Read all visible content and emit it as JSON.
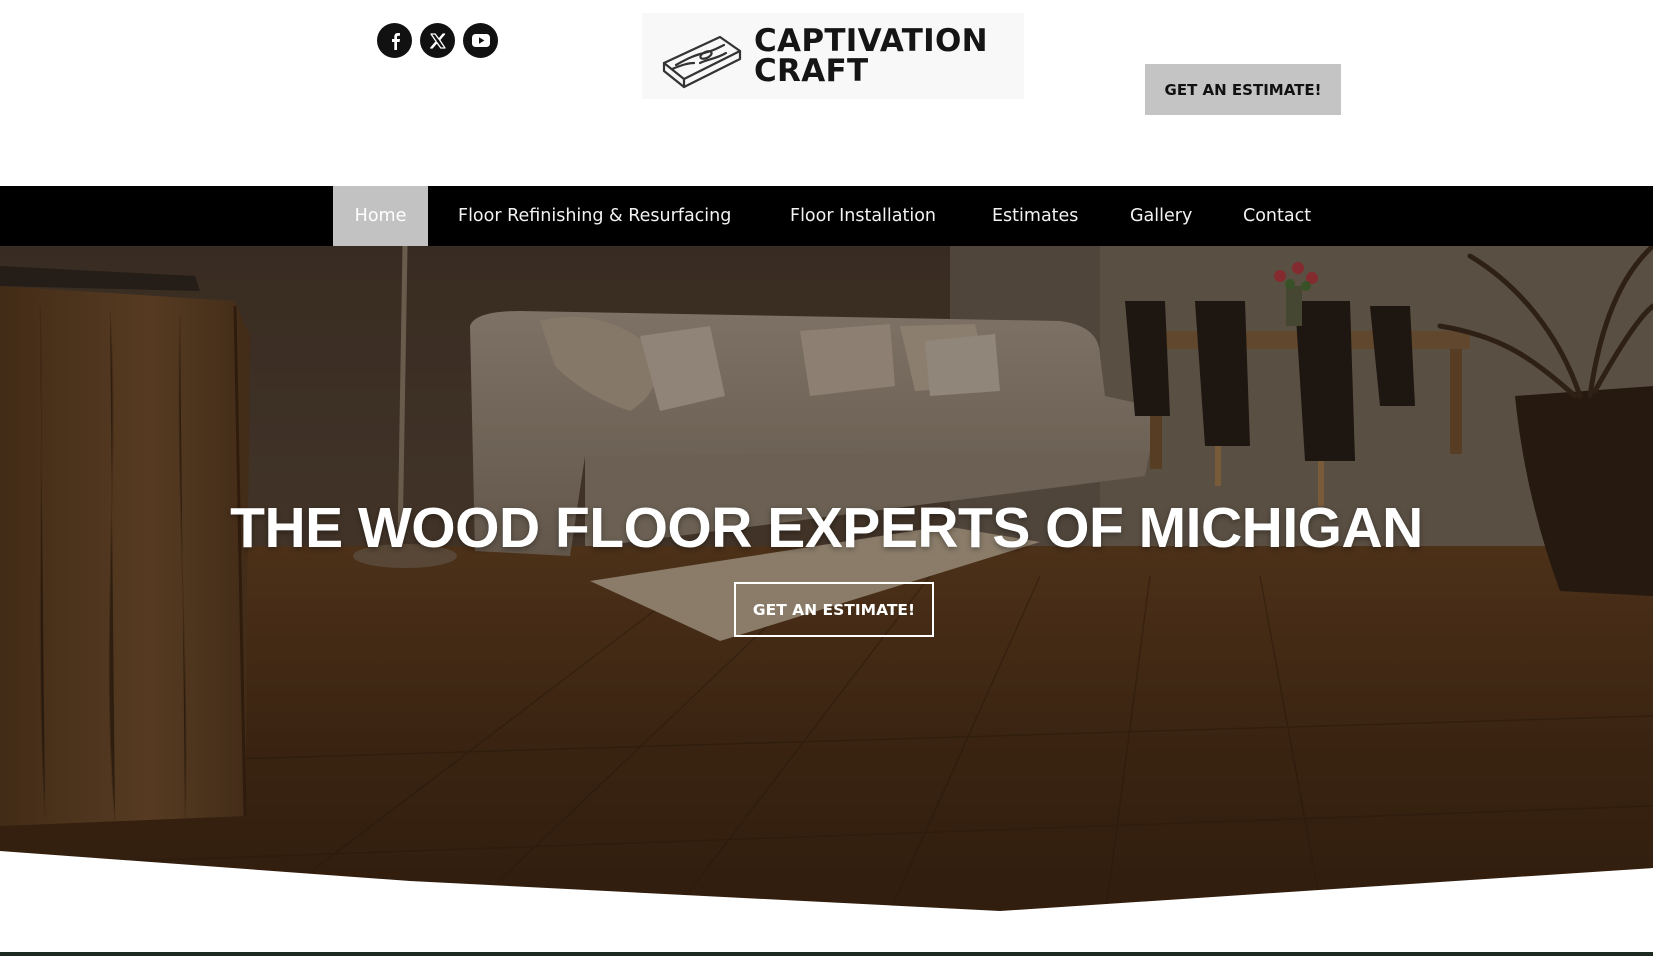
{
  "header": {
    "social": [
      {
        "name": "facebook",
        "icon": "facebook-icon"
      },
      {
        "name": "x",
        "icon": "x-icon"
      },
      {
        "name": "youtube",
        "icon": "youtube-icon"
      }
    ],
    "logo": {
      "line1": "CAPTIVATION",
      "line2": "CRAFT",
      "icon": "wood-plank-icon"
    },
    "cta_label": "GET AN ESTIMATE!"
  },
  "nav": {
    "items": [
      {
        "label": "Home",
        "active": true
      },
      {
        "label": "Floor Refinishing & Resurfacing",
        "active": false
      },
      {
        "label": "Floor Installation",
        "active": false
      },
      {
        "label": "Estimates",
        "active": false
      },
      {
        "label": "Gallery",
        "active": false
      },
      {
        "label": "Contact",
        "active": false
      }
    ]
  },
  "hero": {
    "title": "THE WOOD FLOOR EXPERTS OF MICHIGAN",
    "cta_label": "GET AN ESTIMATE!",
    "image": "living-room-hardwood-floor-photo"
  },
  "colors": {
    "nav_bg": "#000000",
    "nav_active": "#c2c2c2",
    "button_gray": "#c4c4c4",
    "text_dark": "#111111",
    "hero_overlay": "#3a2614"
  }
}
